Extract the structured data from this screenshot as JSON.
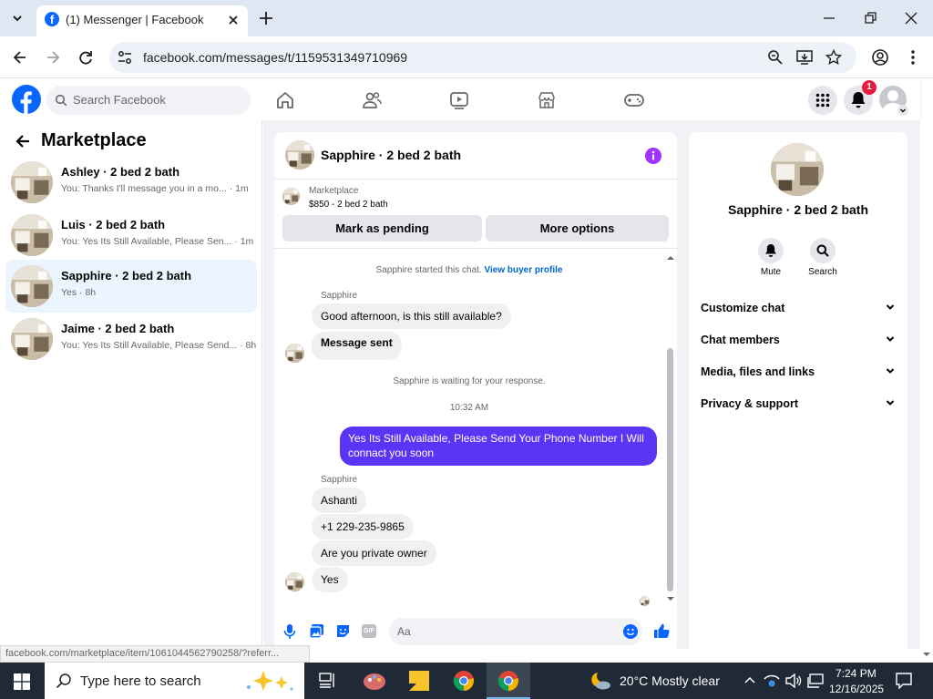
{
  "browser": {
    "tab_title": "(1) Messenger | Facebook",
    "url": "facebook.com/messages/t/1159531349710969",
    "status_url": "facebook.com/marketplace/item/1061044562790258/?referr..."
  },
  "fb_header": {
    "search_placeholder": "Search Facebook",
    "notification_count": "1"
  },
  "sidebar": {
    "title": "Marketplace",
    "conversations": [
      {
        "name": "Ashley · 2 bed 2 bath",
        "preview": "You: Thanks I'll message you in a mo... · 1m",
        "active": false
      },
      {
        "name": "Luis · 2 bed 2 bath",
        "preview": "You: Yes Its Still Available, Please Sen... · 1m",
        "active": false
      },
      {
        "name": "Sapphire · 2 bed 2 bath",
        "preview": "Yes · 8h",
        "active": true
      },
      {
        "name": "Jaime · 2 bed 2 bath",
        "preview": "You: Yes Its Still Available, Please Send... · 8h",
        "active": false
      }
    ]
  },
  "chat": {
    "title": "Sapphire · 2 bed 2 bath",
    "listing_source": "Marketplace",
    "listing": "$850 - 2 bed 2 bath",
    "mark_pending_label": "Mark as pending",
    "more_options_label": "More options",
    "started_text": "Sapphire started this chat.",
    "view_profile_label": "View buyer profile",
    "sender_name": "Sapphire",
    "msg1": "Good afternoon, is this still available?",
    "msg2": "Message sent",
    "waiting_text": "Sapphire is waiting for your response.",
    "timestamp": "10:32 AM",
    "outgoing": "Yes Its Still Available, Please Send Your Phone Number I Will connact you soon",
    "msg3": "Ashanti",
    "msg4": "+1 229-235-9865",
    "msg5": "Are you private owner",
    "msg6": "Yes",
    "composer_placeholder": "Aa"
  },
  "right_panel": {
    "name": "Sapphire · 2 bed 2 bath",
    "mute_label": "Mute",
    "search_label": "Search",
    "sections": [
      "Customize chat",
      "Chat members",
      "Media, files and links",
      "Privacy & support"
    ]
  },
  "taskbar": {
    "search_placeholder": "Type here to search",
    "weather": "20°C  Mostly clear",
    "time": "7:24 PM",
    "date": "12/16/2025"
  },
  "colors": {
    "fb_blue": "#0866ff",
    "outgoing_bubble": "#5b35f5",
    "badge_red": "#e41e3f",
    "info_purple": "#a033ff"
  }
}
